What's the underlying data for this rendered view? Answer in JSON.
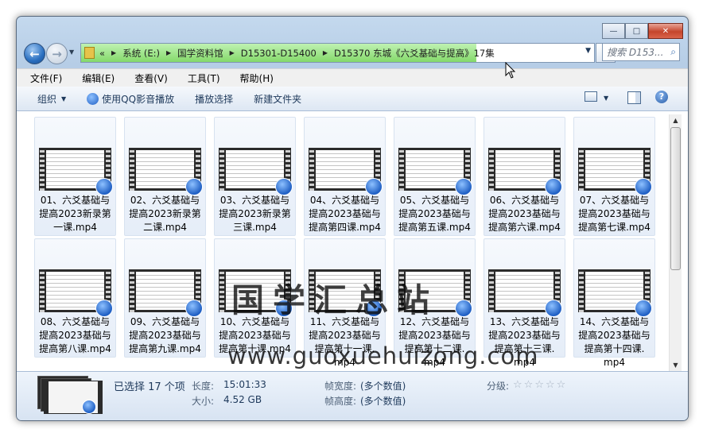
{
  "window": {
    "caption_buttons": {
      "minimize": "—",
      "maximize": "□",
      "close": "✕"
    }
  },
  "address": {
    "overflow": "«",
    "crumbs": [
      "系统 (E:)",
      "国学资料馆",
      "D15301-D15400",
      "D15370 东城《六爻基础与提高》17集"
    ],
    "search_placeholder": "搜索 D153..."
  },
  "menu": [
    "文件(F)",
    "编辑(E)",
    "查看(V)",
    "工具(T)",
    "帮助(H)"
  ],
  "toolbar": {
    "organize": "组织",
    "play_qq": "使用QQ影音播放",
    "play_selection": "播放选择",
    "new_folder": "新建文件夹"
  },
  "files": [
    "01、六爻基础与提高2023新录第一课.mp4",
    "02、六爻基础与提高2023新录第二课.mp4",
    "03、六爻基础与提高2023新录第三课.mp4",
    "04、六爻基础与提高2023基础与提高第四课.mp4",
    "05、六爻基础与提高2023基础与提高第五课.mp4",
    "06、六爻基础与提高2023基础与提高第六课.mp4",
    "07、六爻基础与提高2023基础与提高第七课.mp4",
    "08、六爻基础与提高2023基础与提高第八课.mp4",
    "09、六爻基础与提高2023基础与提高第九课.mp4",
    "10、六爻基础与提高2023基础与提高第十课.mp4",
    "11、六爻基础与提高2023基础与提高第十一课.mp4",
    "12、六爻基础与提高2023基础与提高第十二课.mp4",
    "13、六爻基础与提高2023基础与提高第十三课.mp4",
    "14、六爻基础与提高2023基础与提高第十四课.mp4"
  ],
  "captions": [
    [
      "01、六爻基础与",
      "提高2023新录第",
      "一课.mp4"
    ],
    [
      "02、六爻基础与",
      "提高2023新录第",
      "二课.mp4"
    ],
    [
      "03、六爻基础与",
      "提高2023新录第",
      "三课.mp4"
    ],
    [
      "04、六爻基础与",
      "提高2023基础与",
      "提高第四课.mp4"
    ],
    [
      "05、六爻基础与",
      "提高2023基础与",
      "提高第五课.mp4"
    ],
    [
      "06、六爻基础与",
      "提高2023基础与",
      "提高第六课.mp4"
    ],
    [
      "07、六爻基础与",
      "提高2023基础与",
      "提高第七课.mp4"
    ],
    [
      "08、六爻基础与",
      "提高2023基础与",
      "提高第八课.mp4"
    ],
    [
      "09、六爻基础与",
      "提高2023基础与",
      "提高第九课.mp4"
    ],
    [
      "10、六爻基础与",
      "提高2023基础与",
      "提高第十课.mp4"
    ],
    [
      "11、六爻基础与",
      "提高2023基础与",
      "提高第十一课.",
      "mp4"
    ],
    [
      "12、六爻基础与",
      "提高2023基础与",
      "提高第十二课.",
      "mp4"
    ],
    [
      "13、六爻基础与",
      "提高2023基础与",
      "提高第十三课.",
      "mp4"
    ],
    [
      "14、六爻基础与",
      "提高2023基础与",
      "提高第十四课.",
      "mp4"
    ]
  ],
  "watermark": {
    "title": "国学汇总站",
    "url": "www.guoxuehuizong.com"
  },
  "status": {
    "selected": "已选择 17 个项",
    "length_label": "长度:",
    "length_value": "15:01:33",
    "size_label": "大小:",
    "size_value": "4.52 GB",
    "frame_width_label": "帧宽度:",
    "frame_width_value": "(多个数值)",
    "frame_height_label": "帧高度:",
    "frame_height_value": "(多个数值)",
    "rating_label": "分级:",
    "rating": 0
  },
  "colors": {
    "address_progress": "#84d96a",
    "accent": "#1e395b",
    "close_button": "#c5452c"
  }
}
